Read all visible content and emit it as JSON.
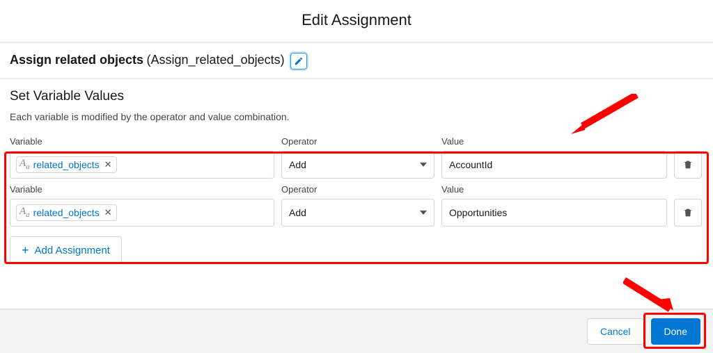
{
  "modal": {
    "title": "Edit Assignment"
  },
  "element": {
    "label_prefix": "Assign related objects",
    "api_name": "(Assign_related_objects)"
  },
  "section": {
    "title": "Set Variable Values",
    "description": "Each variable is modified by the operator and value combination."
  },
  "columns": {
    "variable": "Variable",
    "operator": "Operator",
    "value": "Value"
  },
  "rows": [
    {
      "variable": "related_objects",
      "operator": "Add",
      "value": "AccountId"
    },
    {
      "variable": "related_objects",
      "operator": "Add",
      "value": "Opportunities"
    }
  ],
  "actions": {
    "add_assignment": "Add Assignment",
    "cancel": "Cancel",
    "done": "Done"
  }
}
